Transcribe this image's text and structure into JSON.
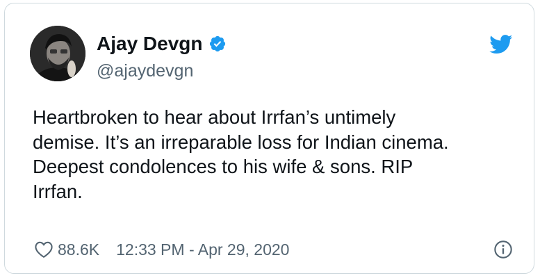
{
  "tweet": {
    "author": {
      "display_name": "Ajay Devgn",
      "handle": "@ajaydevgn",
      "verified": true,
      "avatar": "profile-photo"
    },
    "text_lines": [
      "Heartbroken to hear about Irrfan’s untimely",
      "demise. It’s an irreparable loss for Indian cinema.",
      "Deepest condolences to his wife & sons. RIP",
      "Irrfan."
    ],
    "likes": "88.6K",
    "timestamp": "12:33 PM - Apr 29, 2020"
  },
  "icons": {
    "verified": "verified-badge-icon",
    "brand": "twitter-bird-icon",
    "like": "heart-icon",
    "info": "info-icon"
  },
  "colors": {
    "brand_blue": "#1d9bf0",
    "text_primary": "#0f1419",
    "text_secondary": "#536471",
    "border": "#cfd9de"
  }
}
